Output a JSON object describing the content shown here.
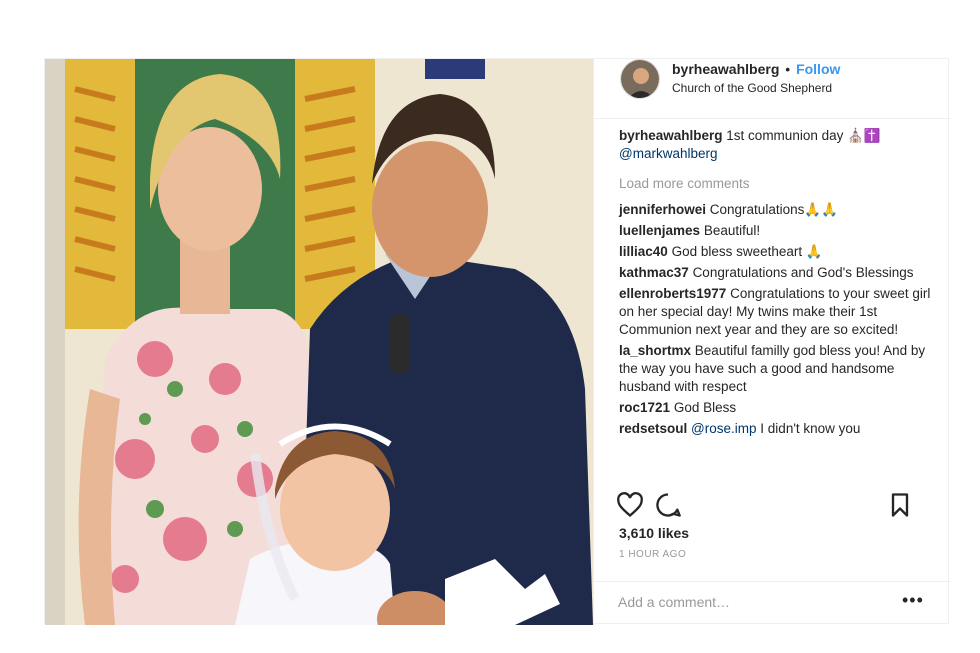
{
  "post": {
    "username": "byrheawahlberg",
    "dot": "•",
    "follow_label": "Follow",
    "location": "Church of the Good Shepherd",
    "caption_user": "byrheawahlberg",
    "caption_text": "1st communion day ⛪✝️",
    "caption_mention": "@markwahlberg",
    "load_more": "Load more comments",
    "likes": "3,610 likes",
    "time": "1 HOUR AGO",
    "add_comment_placeholder": "Add a comment…",
    "more_label": "•••"
  },
  "comments": [
    {
      "user": "jenniferhowei",
      "text": "Congratulations🙏🙏"
    },
    {
      "user": "luellenjames",
      "text": "Beautiful!"
    },
    {
      "user": "lilliac40",
      "text": "God bless sweetheart 🙏"
    },
    {
      "user": "kathmac37",
      "text": "Congratulations and God's Blessings"
    },
    {
      "user": "ellenroberts1977",
      "text": "Congratulations to your sweet girl on her special day! My twins make their 1st Communion next year and they are so excited!"
    },
    {
      "user": "la_shortmx",
      "text": "Beautiful familly god bless you! And by the way you have such a good and handsome husband with respect"
    },
    {
      "user": "roc1721",
      "text": "God Bless"
    },
    {
      "user": "redsetsoul",
      "mention": "@rose.imp",
      "text": "I didn't know you"
    }
  ],
  "icons": {
    "like": "heart-icon",
    "comment": "comment-icon",
    "save": "bookmark-icon",
    "more": "more-options-icon"
  },
  "colors": {
    "link_blue": "#3897f0",
    "mention_blue": "#003569",
    "muted": "#999999",
    "text": "#262626"
  }
}
